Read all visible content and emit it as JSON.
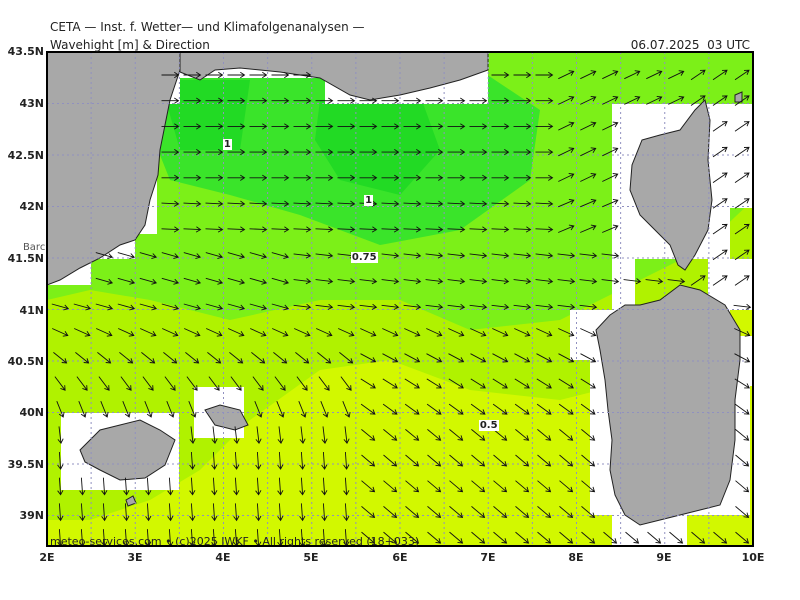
{
  "header": {
    "organization": "CETA — Inst. f. Wetter— und Klimafolgenanalysen —",
    "title": "Wavehight [m] & Direction",
    "datetime": "06.07.2025  03 UTC"
  },
  "footer": "meteo-services.com • (c)2025 IWKF • All rights reserved (18+033)",
  "x_ticks": [
    "2E",
    "3E",
    "4E",
    "5E",
    "6E",
    "7E",
    "8E",
    "9E",
    "10E"
  ],
  "y_ticks": [
    "43.5N",
    "43N",
    "42.5N",
    "42N",
    "41.5N",
    "41N",
    "40.5N",
    "40N",
    "39.5N",
    "39N"
  ],
  "contour_labels": [
    {
      "text": "1",
      "lon": 4.05,
      "lat": 42.6
    },
    {
      "text": "1",
      "lon": 5.65,
      "lat": 42.05
    },
    {
      "text": "0.75",
      "lon": 5.5,
      "lat": 41.5
    },
    {
      "text": "0.5",
      "lon": 6.95,
      "lat": 39.87
    }
  ],
  "place_labels": [
    {
      "text": "Barc",
      "lon": 1.75,
      "lat": 41.6
    }
  ],
  "colors": {
    "land": "#a8a8a8",
    "wave_1_0": "#22e628",
    "wave_0_75": "#6cf018",
    "wave_0_5": "#b4f400",
    "wave_0_25": "#d8fa00",
    "grid": "#9090c0"
  },
  "arrow_icon": "wave-direction-arrow-icon"
}
